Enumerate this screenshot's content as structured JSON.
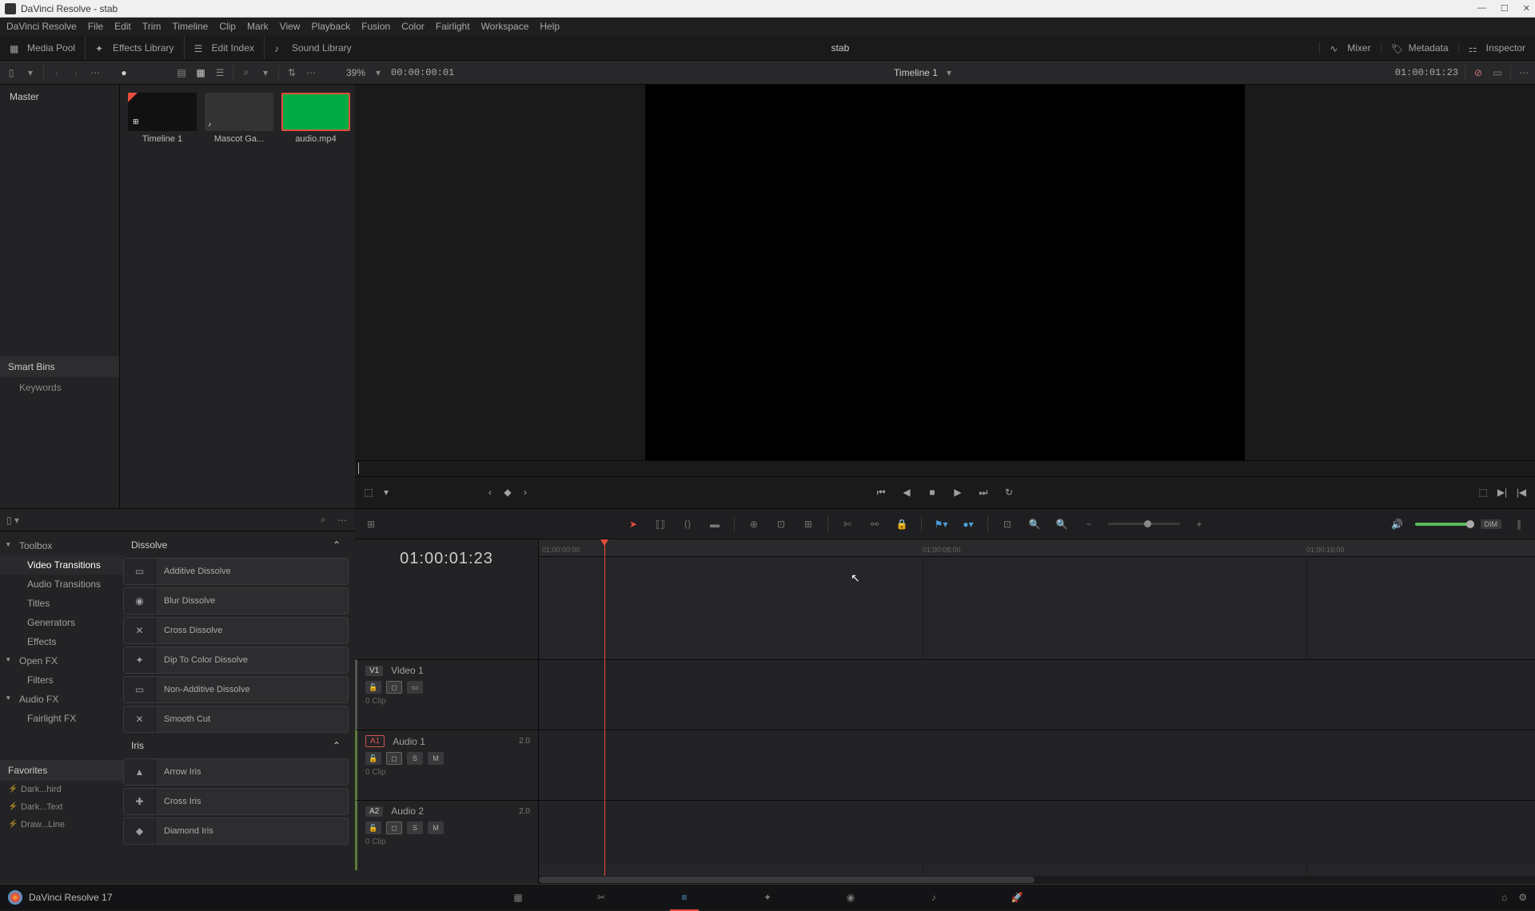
{
  "window": {
    "title": "DaVinci Resolve - stab"
  },
  "menu": [
    "DaVinci Resolve",
    "File",
    "Edit",
    "Trim",
    "Timeline",
    "Clip",
    "Mark",
    "View",
    "Playback",
    "Fusion",
    "Color",
    "Fairlight",
    "Workspace",
    "Help"
  ],
  "workspace": {
    "media_pool": "Media Pool",
    "effects": "Effects Library",
    "edit_index": "Edit Index",
    "sound": "Sound Library",
    "project": "stab",
    "mixer": "Mixer",
    "metadata": "Metadata",
    "inspector": "Inspector"
  },
  "toolbar": {
    "zoom_pct": "39%",
    "src_tc": "00:00:00:01",
    "timeline_name": "Timeline 1",
    "rec_tc": "01:00:01:23"
  },
  "bins": {
    "master": "Master",
    "smart_hdr": "Smart Bins",
    "keywords": "Keywords"
  },
  "clips": [
    {
      "name": "Timeline 1",
      "kind": "timeline"
    },
    {
      "name": "Mascot Ga...",
      "kind": "video"
    },
    {
      "name": "audio.mp4",
      "kind": "audio"
    }
  ],
  "fx_tree": {
    "toolbox": "Toolbox",
    "video_trans": "Video Transitions",
    "audio_trans": "Audio Transitions",
    "titles": "Titles",
    "generators": "Generators",
    "effects": "Effects",
    "openfx": "Open FX",
    "filters": "Filters",
    "audiofx": "Audio FX",
    "fairlight": "Fairlight FX",
    "favorites": "Favorites",
    "fav_items": [
      "Dark...hird",
      "Dark...Text",
      "Draw...Line"
    ]
  },
  "fx_list": {
    "dissolve_hdr": "Dissolve",
    "dissolve": [
      "Additive Dissolve",
      "Blur Dissolve",
      "Cross Dissolve",
      "Dip To Color Dissolve",
      "Non-Additive Dissolve",
      "Smooth Cut"
    ],
    "iris_hdr": "Iris",
    "iris": [
      "Arrow Iris",
      "Cross Iris",
      "Diamond Iris"
    ]
  },
  "timeline": {
    "tc": "01:00:01:23",
    "dim": "DIM",
    "ruler": [
      "01:00:00:00",
      "01:00:08:00",
      "01:00:16:00"
    ],
    "v1": {
      "badge": "V1",
      "name": "Video 1",
      "clips": "0 Clip"
    },
    "a1": {
      "badge": "A1",
      "name": "Audio 1",
      "clips": "0 Clip",
      "ch": "2.0",
      "s": "S",
      "m": "M"
    },
    "a2": {
      "badge": "A2",
      "name": "Audio 2",
      "clips": "0 Clip",
      "ch": "2.0",
      "s": "S",
      "m": "M"
    }
  },
  "footer": {
    "app": "DaVinci Resolve 17"
  }
}
